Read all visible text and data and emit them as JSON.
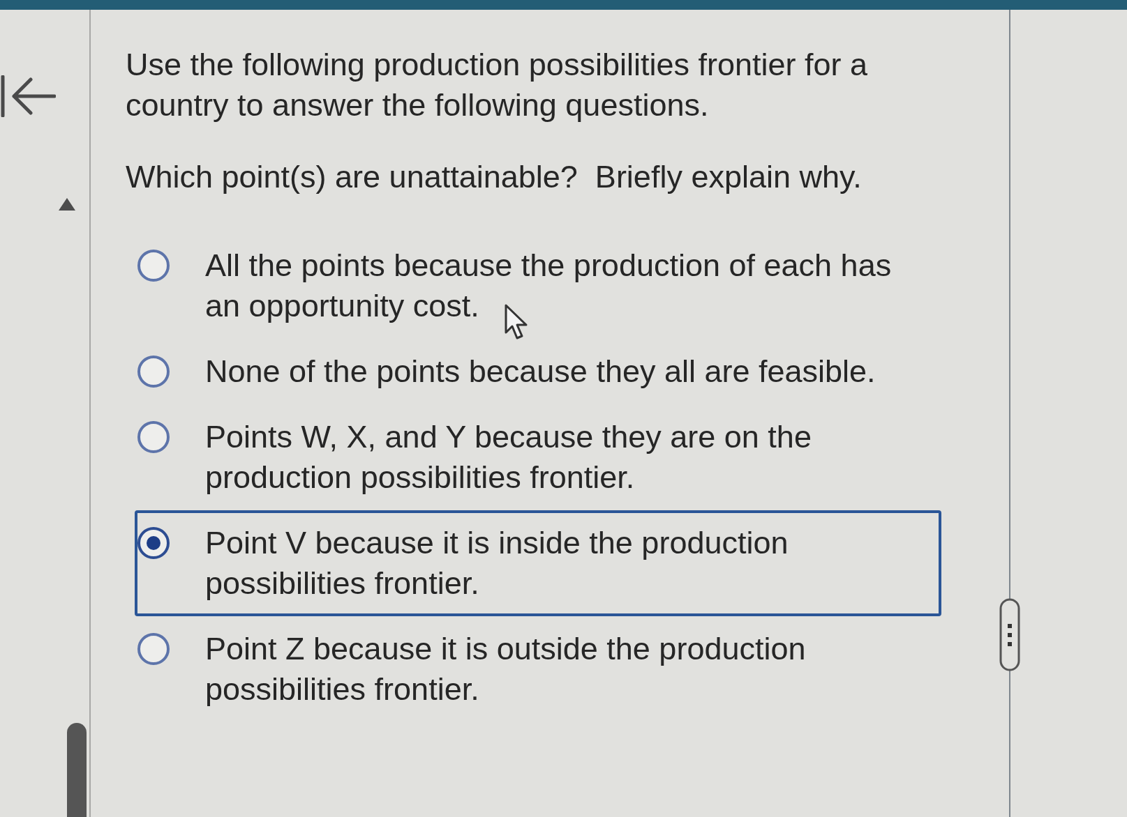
{
  "question": {
    "intro": "Use the following production possibilities frontier for a country to answer the following questions.",
    "prompt": "Which point(s) are unattainable?  Briefly explain why."
  },
  "options": [
    {
      "text": "All the points because the production of each has an opportunity cost.",
      "selected": false
    },
    {
      "text": "None of the points because they all are feasible.",
      "selected": false
    },
    {
      "text": "Points W, X, and Y because they are on the production possibilities frontier.",
      "selected": false
    },
    {
      "text": "Point V because it is inside the production possibilities frontier.",
      "selected": true
    },
    {
      "text": "Point Z because it is outside the production possibilities frontier.",
      "selected": false
    }
  ]
}
